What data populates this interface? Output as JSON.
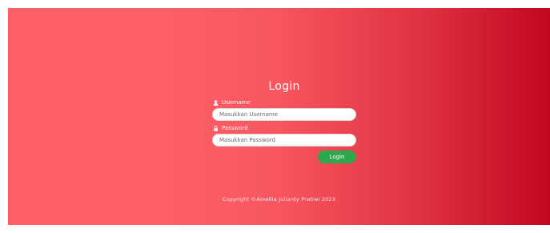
{
  "login": {
    "title": "Login",
    "username": {
      "label": "Username",
      "icon": "user-icon",
      "placeholder": "Masukkan Username",
      "value": ""
    },
    "password": {
      "label": "Password",
      "icon": "lock-icon",
      "placeholder": "Masukkan Password",
      "value": ""
    },
    "submit_label": "Login"
  },
  "footer": {
    "copyright": "Copyright ©Amellia Julianty Pratiwi 2023"
  },
  "colors": {
    "gradient_start": "#fe5f66",
    "gradient_end": "#c2061f",
    "button": "#2ea84c"
  }
}
